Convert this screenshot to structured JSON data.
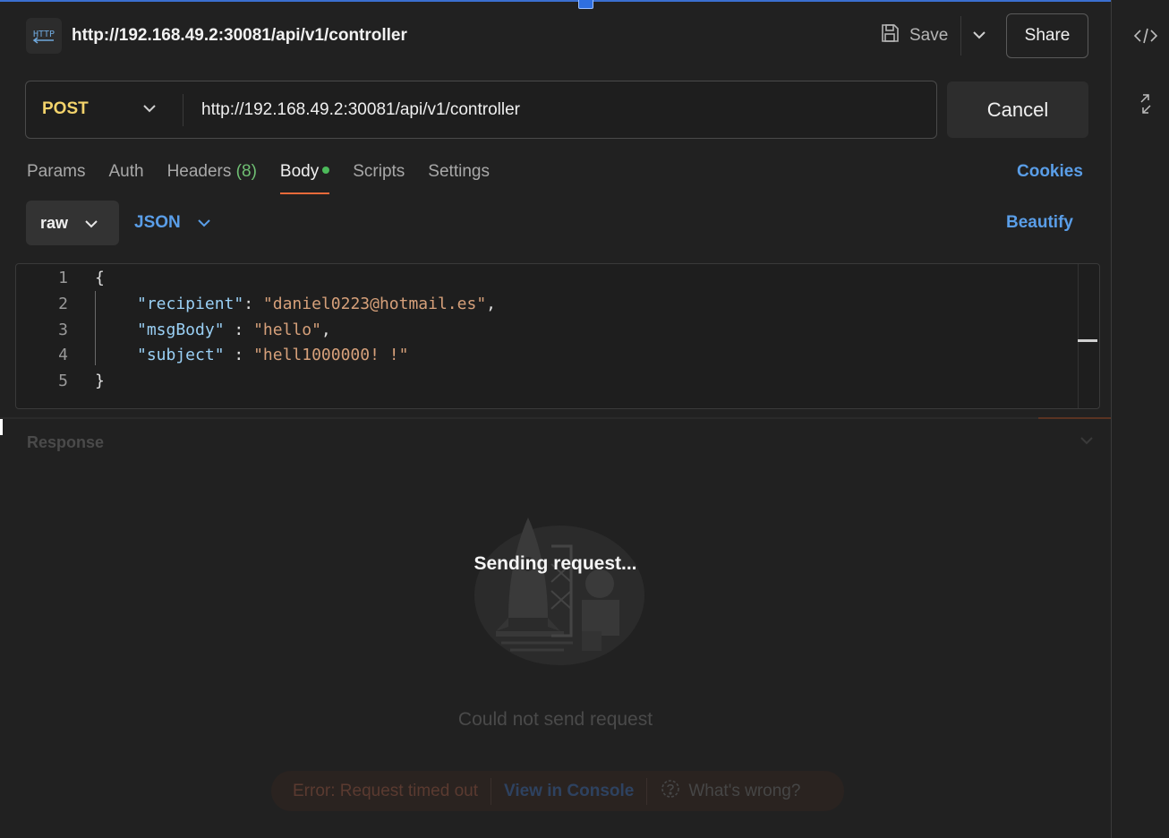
{
  "header": {
    "badge_label": "HTTP",
    "title": "http://192.168.49.2:30081/api/v1/controller",
    "save_label": "Save",
    "share_label": "Share"
  },
  "request": {
    "method": "POST",
    "url": "http://192.168.49.2:30081/api/v1/controller",
    "cancel_label": "Cancel"
  },
  "tabs": [
    {
      "label": "Params"
    },
    {
      "label": "Auth"
    },
    {
      "label": "Headers",
      "count": "(8)"
    },
    {
      "label": "Body",
      "active": true
    },
    {
      "label": "Scripts"
    },
    {
      "label": "Settings"
    }
  ],
  "cookies_label": "Cookies",
  "body_options": {
    "mode": "raw",
    "language": "JSON",
    "beautify_label": "Beautify"
  },
  "editor": {
    "lines": [
      {
        "num": "1",
        "text": "{"
      },
      {
        "num": "2",
        "key": "\"recipient\"",
        "sep": ": ",
        "value": "\"daniel0223@hotmail.es\"",
        "end": ","
      },
      {
        "num": "3",
        "key": "\"msgBody\"",
        "sep": " : ",
        "value": "\"hello\"",
        "end": ","
      },
      {
        "num": "4",
        "key": "\"subject\"",
        "sep": " : ",
        "value": "\"hell1000000! !\"",
        "end": ""
      },
      {
        "num": "5",
        "text": "}"
      }
    ]
  },
  "response": {
    "label": "Response",
    "status_text": "Sending request...",
    "empty_text": "Could not send request",
    "error_text": "Error: Request timed out",
    "console_link": "View in Console",
    "help_link": "What's wrong?"
  },
  "colors": {
    "accent_blue": "#5a9ee8",
    "method_yellow": "#f3d36b",
    "active_tab_underline": "#e86a3a",
    "body_dot_green": "#4cba5a"
  }
}
